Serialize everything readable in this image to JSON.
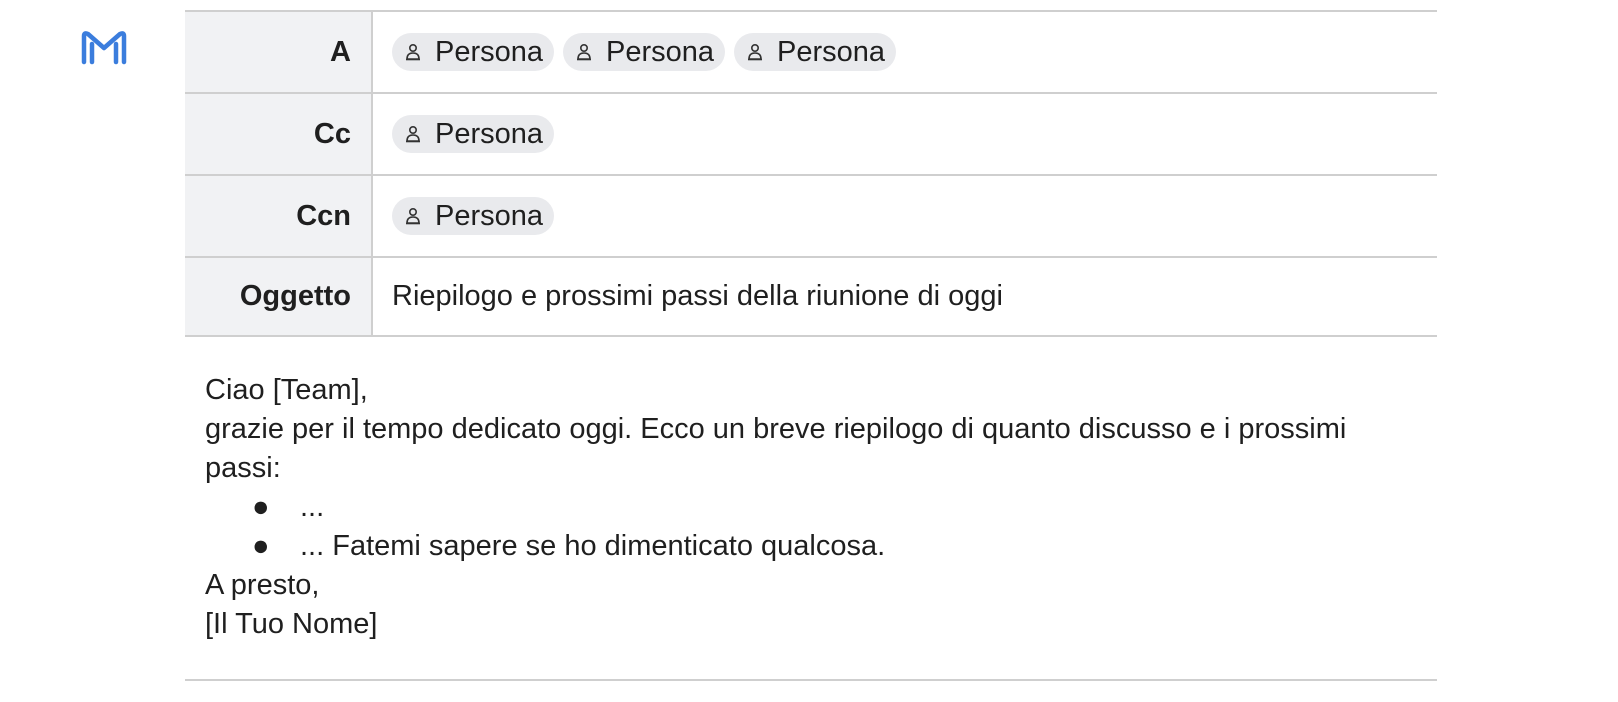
{
  "app": {
    "logo_icon": "gmail-logo-icon",
    "accent_color": "#3b7ddd"
  },
  "fields": {
    "to": {
      "label": "A",
      "recipients": [
        "Persona",
        "Persona",
        "Persona"
      ]
    },
    "cc": {
      "label": "Cc",
      "recipients": [
        "Persona"
      ]
    },
    "bcc": {
      "label": "Ccn",
      "recipients": [
        "Persona"
      ]
    },
    "subject": {
      "label": "Oggetto",
      "value": "Riepilogo e prossimi passi della riunione di oggi"
    }
  },
  "body": {
    "greeting": "Ciao [Team],",
    "intro": "grazie per il tempo dedicato oggi. Ecco un breve riepilogo di quanto discusso e i prossimi passi:",
    "bullet_symbol": "●",
    "bullets": [
      "...",
      "... Fatemi sapere se ho dimenticato qualcosa."
    ],
    "closing": "A presto,",
    "signature": "[Il Tuo Nome]"
  }
}
